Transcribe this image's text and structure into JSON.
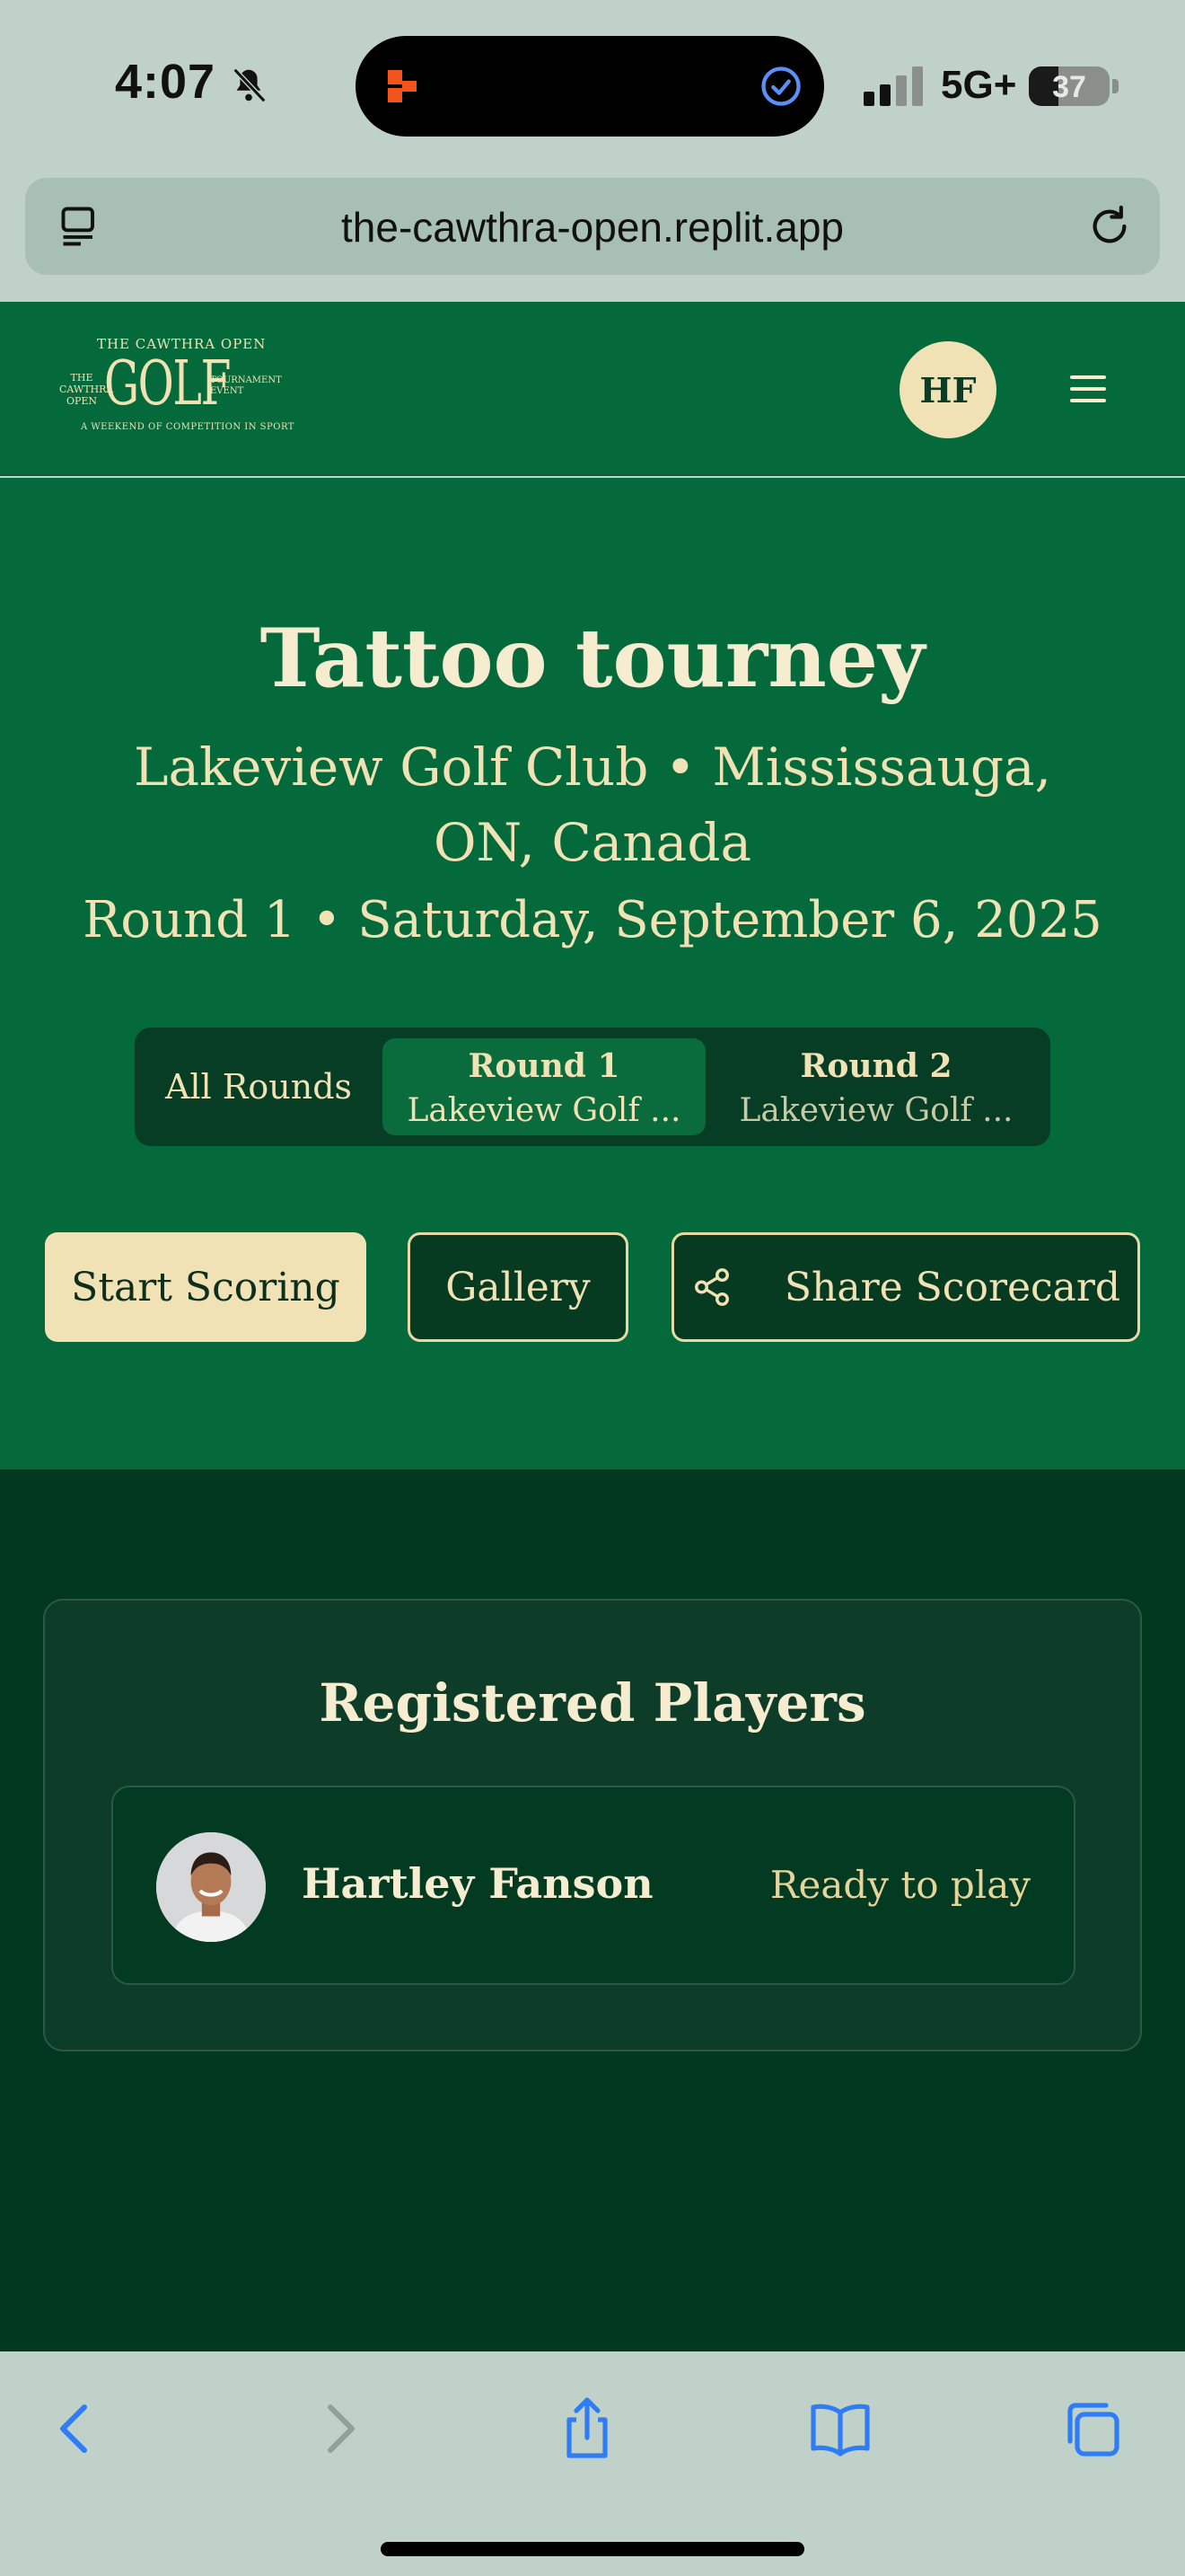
{
  "status_bar": {
    "time": "4:07",
    "network": "5G+",
    "battery_percent": 37,
    "battery_label": "37"
  },
  "browser": {
    "url": "the-cawthra-open.replit.app"
  },
  "header": {
    "logo": {
      "top_line": "THE CAWTHRA OPEN",
      "main_word": "GOLF",
      "left_text": "THE CAWTHRA OPEN",
      "right_text": "TOURNAMENT EVENT",
      "bottom_line": "A WEEKEND OF COMPETITION IN SPORT"
    },
    "user_initials": "HF"
  },
  "tournament": {
    "title": "Tattoo tourney",
    "venue": "Lakeview Golf Club • Mississauga, ON, Canada",
    "round_info": "Round 1 • Saturday, September 6, 2025"
  },
  "round_tabs": [
    {
      "label": "All Rounds",
      "sub": "",
      "active": false
    },
    {
      "label": "Round 1",
      "sub": "Lakeview Golf ...",
      "active": true
    },
    {
      "label": "Round 2",
      "sub": "Lakeview Golf ...",
      "active": false
    }
  ],
  "actions": {
    "start_scoring": "Start Scoring",
    "gallery": "Gallery",
    "share_scorecard": "Share Scorecard"
  },
  "players": {
    "title": "Registered Players",
    "list": [
      {
        "name": "Hartley Fanson",
        "status": "Ready to play"
      }
    ]
  },
  "colors": {
    "brand_green": "#046a3c",
    "dark_green": "#033820",
    "cream": "#f1e2b5"
  }
}
